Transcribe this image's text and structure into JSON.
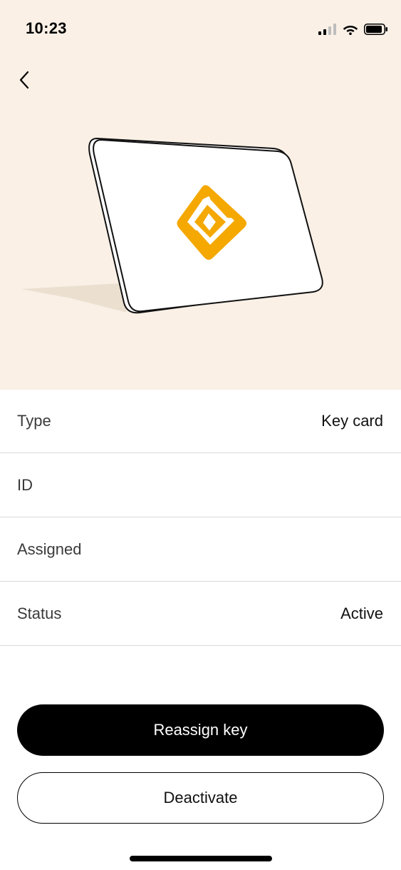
{
  "status_bar": {
    "time": "10:23",
    "icons": [
      "cellular-signal-icon",
      "wifi-icon",
      "battery-icon"
    ]
  },
  "header": {
    "back_icon": "chevron-left-icon"
  },
  "illustration": {
    "description_icon": "key-card-illustration",
    "logo_icon": "brand-logo-icon",
    "colors": {
      "background": "#faf0e6",
      "card": "#ffffff",
      "logo": "#f4a800",
      "shadow": "#ebe0cf"
    }
  },
  "details": {
    "rows": [
      {
        "label": "Type",
        "value": "Key card"
      },
      {
        "label": "ID",
        "value": ""
      },
      {
        "label": "Assigned",
        "value": ""
      },
      {
        "label": "Status",
        "value": "Active"
      }
    ]
  },
  "actions": {
    "reassign_label": "Reassign key",
    "deactivate_label": "Deactivate"
  }
}
